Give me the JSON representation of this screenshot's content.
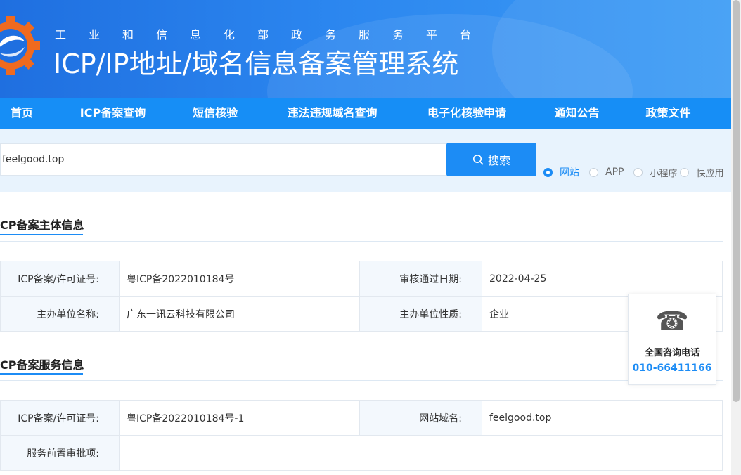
{
  "header": {
    "subtitle": "工业和信息化部政务服务平台",
    "title": "ICP/IP地址/域名信息备案管理系统"
  },
  "nav": [
    {
      "label": "首页",
      "active": false
    },
    {
      "label": "ICP备案查询",
      "active": true
    },
    {
      "label": "短信核验",
      "active": false
    },
    {
      "label": "违法违规域名查询",
      "active": false
    },
    {
      "label": "电子化核验申请",
      "active": false
    },
    {
      "label": "通知公告",
      "active": false
    },
    {
      "label": "政策文件",
      "active": false
    }
  ],
  "search": {
    "value": "feelgood.top",
    "button_label": "搜索",
    "types": [
      {
        "label": "网站",
        "checked": true
      },
      {
        "label": "APP",
        "checked": false
      },
      {
        "label": "小程序",
        "checked": false
      },
      {
        "label": "快应用",
        "checked": false
      }
    ]
  },
  "entity_section": {
    "title": "CP备案主体信息",
    "rows": [
      {
        "label1": "ICP备案/许可证号:",
        "value1": "粤ICP备2022010184号",
        "label2": "审核通过日期:",
        "value2": "2022-04-25"
      },
      {
        "label1": "主办单位名称:",
        "value1": "广东一讯云科技有限公司",
        "label2": "主办单位性质:",
        "value2": "企业"
      }
    ]
  },
  "service_section": {
    "title": "CP备案服务信息",
    "rows": [
      {
        "label1": "ICP备案/许可证号:",
        "value1": "粤ICP备2022010184号-1",
        "label2": "网站域名:",
        "value2": "feelgood.top"
      },
      {
        "label1": "服务前置审批项:",
        "value1": ""
      }
    ]
  },
  "consult": {
    "label": "全国咨询电话",
    "number": "010-66411166"
  },
  "colors": {
    "primary": "#1c8cf5",
    "nav_bg": "#168ef6",
    "nav_active": "#42a8ff"
  }
}
